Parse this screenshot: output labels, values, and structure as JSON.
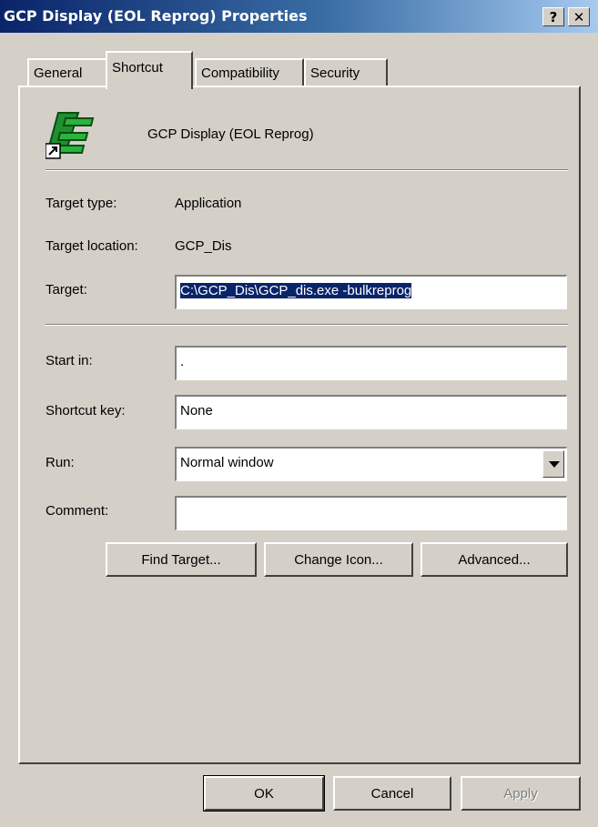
{
  "window": {
    "title": "GCP Display (EOL Reprog) Properties",
    "help_glyph": "?",
    "close_glyph": "✕"
  },
  "tabs": [
    {
      "label": "General",
      "active": false
    },
    {
      "label": "Shortcut",
      "active": true
    },
    {
      "label": "Compatibility",
      "active": false
    },
    {
      "label": "Security",
      "active": false
    }
  ],
  "shortcut": {
    "name": "GCP Display (EOL Reprog)",
    "icon": "application-shortcut-icon",
    "target_type_label": "Target type:",
    "target_type_value": "Application",
    "target_location_label": "Target location:",
    "target_location_value": "GCP_Dis",
    "target_label": "Target:",
    "target_value": "C:\\GCP_Dis\\GCP_dis.exe -bulkreprog",
    "start_in_label": "Start in:",
    "start_in_value": ".",
    "shortcut_key_label": "Shortcut key:",
    "shortcut_key_value": "None",
    "run_label": "Run:",
    "run_value": "Normal window",
    "comment_label": "Comment:",
    "comment_value": ""
  },
  "buttons": {
    "find_target": "Find Target...",
    "change_icon": "Change Icon...",
    "advanced": "Advanced...",
    "ok": "OK",
    "cancel": "Cancel",
    "apply": "Apply"
  },
  "colors": {
    "title_bar": "#0a246a",
    "selection": "#0a246a",
    "face": "#d4d0c8"
  }
}
